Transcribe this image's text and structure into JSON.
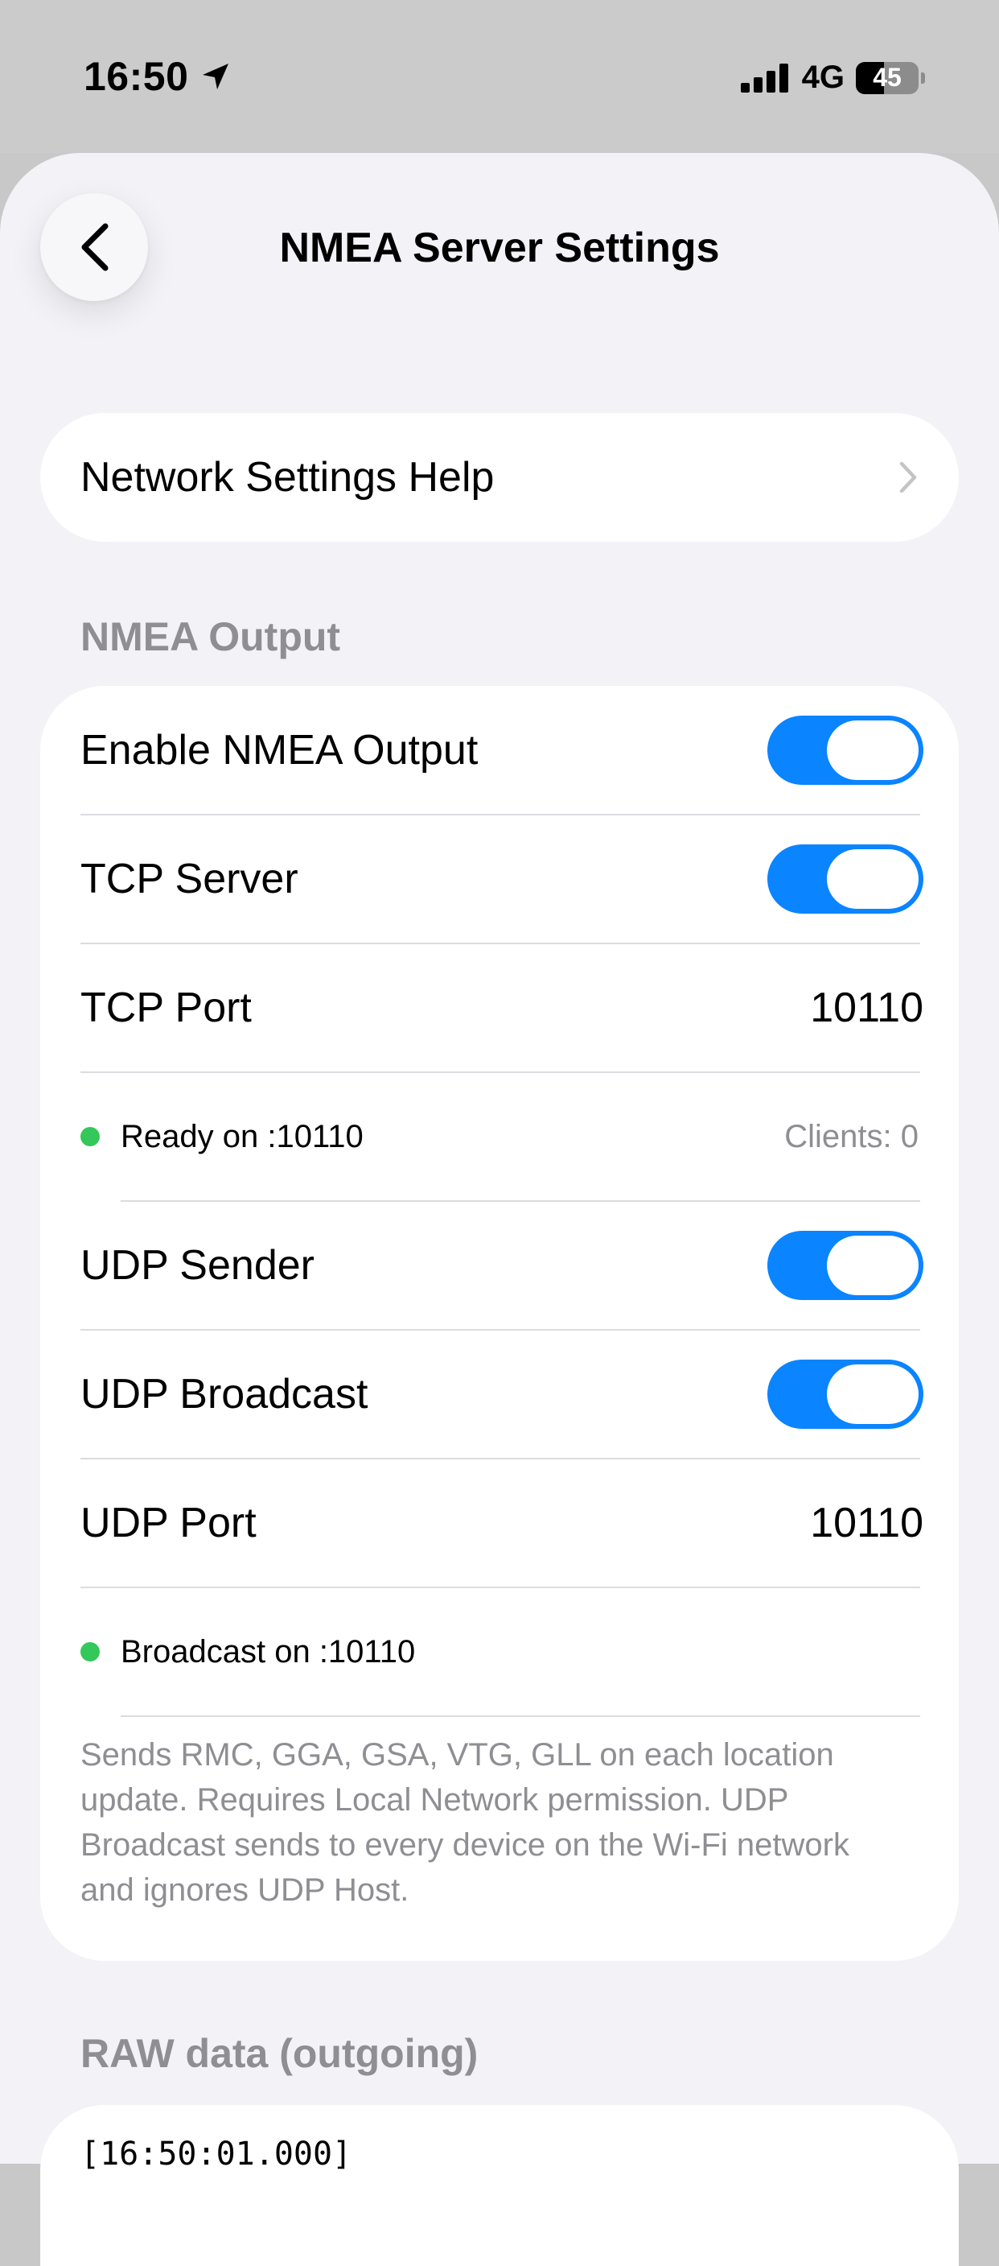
{
  "status_bar": {
    "time": "16:50",
    "network": "4G",
    "battery_percent": 45,
    "battery_label": "45"
  },
  "nav": {
    "title": "NMEA Server Settings"
  },
  "help": {
    "label": "Network Settings Help"
  },
  "nmea_output": {
    "header": "NMEA Output",
    "enable_label": "Enable NMEA Output",
    "enable_on": true,
    "tcp_server_label": "TCP Server",
    "tcp_server_on": true,
    "tcp_port_label": "TCP Port",
    "tcp_port_value": "10110",
    "tcp_status": "Ready on :10110",
    "tcp_clients": "Clients: 0",
    "udp_sender_label": "UDP Sender",
    "udp_sender_on": true,
    "udp_broadcast_label": "UDP Broadcast",
    "udp_broadcast_on": true,
    "udp_port_label": "UDP Port",
    "udp_port_value": "10110",
    "udp_status": "Broadcast on :10110",
    "footnote": "Sends RMC, GGA, GSA, VTG, GLL on each location update. Requires Local Network permission. UDP Broadcast sends to every device on the Wi-Fi network and ignores UDP Host."
  },
  "raw_data": {
    "header": "RAW data (outgoing)",
    "first_line": "[16:50:01.000]"
  },
  "colors": {
    "accent": "#0a84ff",
    "status_green": "#34c759",
    "secondary_text": "#8e8e93",
    "background": "#f2f2f7"
  }
}
